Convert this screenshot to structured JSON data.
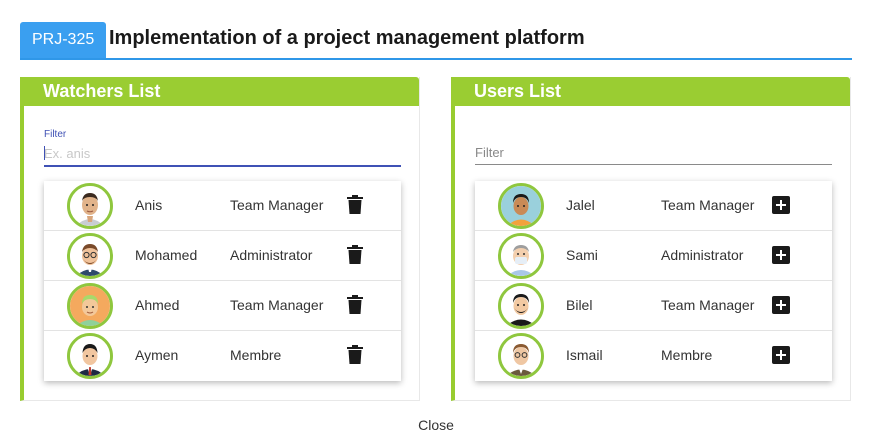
{
  "header": {
    "badge": "PRJ-325",
    "title": "Implementation of a project management platform"
  },
  "watchers": {
    "title": "Watchers List",
    "filter_label": "Filter",
    "filter_placeholder": "Ex. anis",
    "rows": [
      {
        "name": "Anis",
        "role": "Team Manager"
      },
      {
        "name": "Mohamed",
        "role": "Administrator"
      },
      {
        "name": "Ahmed",
        "role": "Team Manager"
      },
      {
        "name": "Aymen",
        "role": "Membre"
      }
    ]
  },
  "users": {
    "title": "Users List",
    "filter_placeholder": "Filter",
    "rows": [
      {
        "name": "Jalel",
        "role": "Team Manager"
      },
      {
        "name": "Sami",
        "role": "Administrator"
      },
      {
        "name": "Bilel",
        "role": "Team Manager"
      },
      {
        "name": "Ismail",
        "role": "Membre"
      }
    ]
  },
  "footer": {
    "close_label": "Close"
  },
  "colors": {
    "accent_green": "#9acd32",
    "accent_blue": "#2f97e8",
    "badge_blue": "#3a9ff0",
    "input_focus": "#3f51b5"
  },
  "icons": {
    "watcher_action": "trash-icon",
    "user_action": "add-box-icon"
  }
}
